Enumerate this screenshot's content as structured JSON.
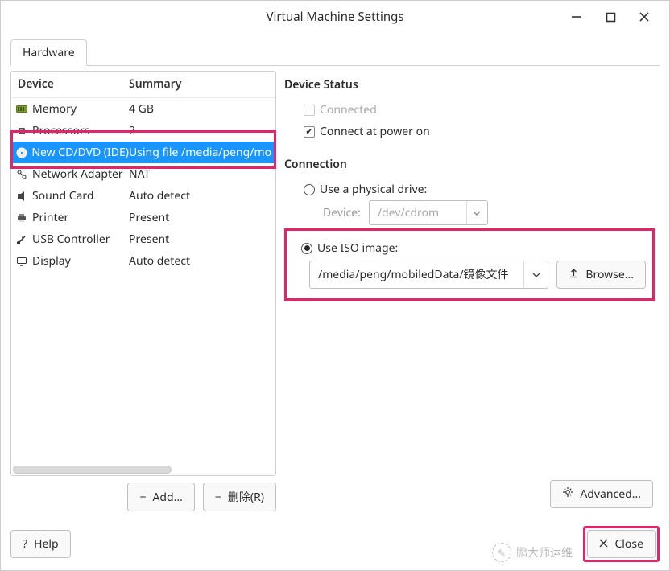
{
  "title": "Virtual Machine Settings",
  "tabs": {
    "hardware": "Hardware"
  },
  "columns": {
    "device": "Device",
    "summary": "Summary"
  },
  "devices": [
    {
      "icon": "memory-icon",
      "name": "Memory",
      "summary": "4 GB"
    },
    {
      "icon": "cpu-icon",
      "name": "Processors",
      "summary": "2"
    },
    {
      "icon": "disc-icon",
      "name": "New CD/DVD (IDE)",
      "summary": "Using file /media/peng/mo"
    },
    {
      "icon": "network-icon",
      "name": "Network Adapter",
      "summary": "NAT"
    },
    {
      "icon": "sound-icon",
      "name": "Sound Card",
      "summary": "Auto detect"
    },
    {
      "icon": "printer-icon",
      "name": "Printer",
      "summary": "Present"
    },
    {
      "icon": "usb-icon",
      "name": "USB Controller",
      "summary": "Present"
    },
    {
      "icon": "display-icon",
      "name": "Display",
      "summary": "Auto detect"
    }
  ],
  "leftButtons": {
    "add": "Add...",
    "remove": "删除(R)"
  },
  "right": {
    "deviceStatus": {
      "title": "Device Status",
      "connected": "Connected",
      "powerOn": "Connect at power on"
    },
    "connection": {
      "title": "Connection",
      "physical": "Use a physical drive:",
      "deviceLabel": "Device:",
      "deviceValue": "/dev/cdrom",
      "iso": "Use ISO image:",
      "isoPath": "/media/peng/mobiledData/镜像文件",
      "browse": "Browse..."
    },
    "advanced": "Advanced..."
  },
  "bottom": {
    "help": "Help",
    "close": "Close"
  },
  "watermark": "鹏大师运维"
}
